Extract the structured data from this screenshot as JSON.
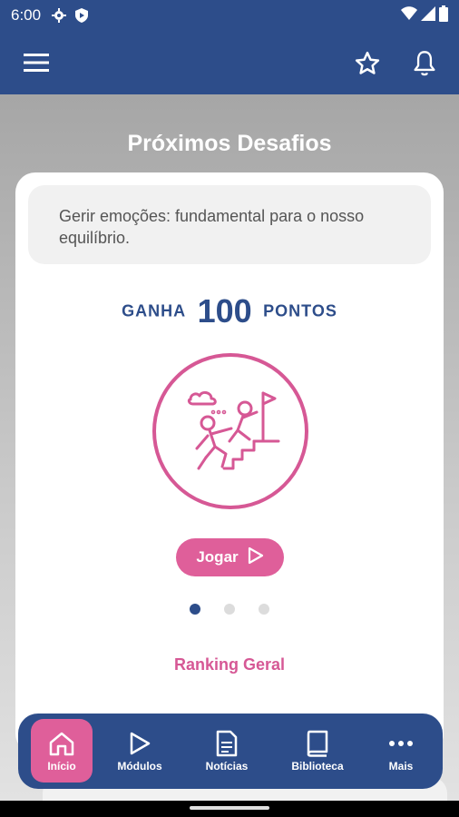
{
  "status_bar": {
    "time": "6:00",
    "icons": [
      "settings-icon",
      "shield-icon",
      "wifi-icon",
      "signal-icon",
      "battery-icon"
    ]
  },
  "app_bar": {
    "icons": [
      "menu-icon",
      "star-icon",
      "bell-icon"
    ]
  },
  "section": {
    "title": "Próximos Desafios"
  },
  "challenge": {
    "text": "Gerir emoções: fundamental para o nosso equilíbrio.",
    "points_prefix": "GANHA",
    "points_value": "100",
    "points_suffix": "PONTOS",
    "play_label": "Jogar",
    "illustration_icon": "climbing-teamwork-icon"
  },
  "carousel": {
    "total": 3,
    "active_index": 0
  },
  "ranking": {
    "label": "Ranking Geral"
  },
  "bottom_nav": {
    "items": [
      {
        "label": "Início",
        "icon": "home-icon",
        "active": true
      },
      {
        "label": "Módulos",
        "icon": "play-icon",
        "active": false
      },
      {
        "label": "Notícias",
        "icon": "document-icon",
        "active": false
      },
      {
        "label": "Biblioteca",
        "icon": "book-icon",
        "active": false
      },
      {
        "label": "Mais",
        "icon": "more-icon",
        "active": false
      }
    ]
  },
  "colors": {
    "primary_blue": "#2d4d8a",
    "accent_pink": "#df5f9a"
  }
}
